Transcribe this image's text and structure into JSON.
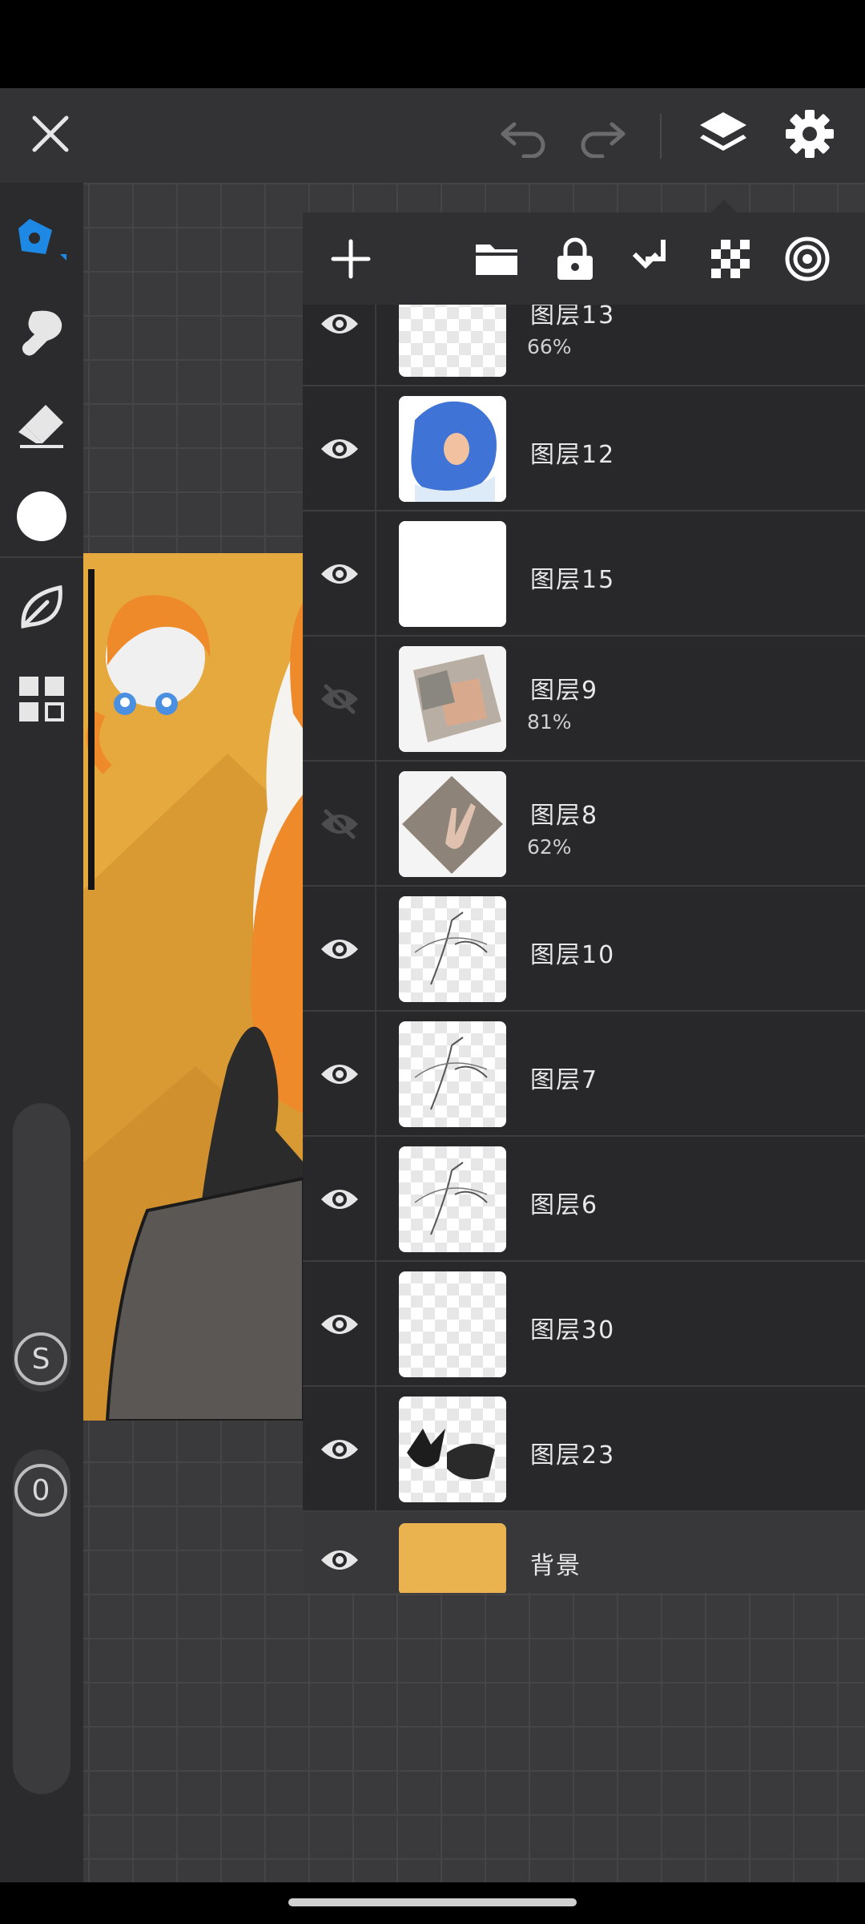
{
  "top_bar": {
    "close_icon": "close-icon",
    "undo_icon": "undo-icon",
    "redo_icon": "redo-icon",
    "layers_icon": "layers-icon",
    "settings_icon": "gear-icon"
  },
  "left_toolbar": {
    "tools": [
      "brush-icon",
      "smudge-icon",
      "eraser-icon",
      "color-swatch",
      "leaf-icon",
      "grid-icon"
    ],
    "active_color": "#ffffff",
    "size_label": "S",
    "opacity_label": "0"
  },
  "layers_toolbar": {
    "icons": [
      "add-layer-icon",
      "folder-icon",
      "lock-icon",
      "merge-down-icon",
      "alpha-lock-icon",
      "target-icon"
    ]
  },
  "layers": [
    {
      "name": "图层13",
      "opacity": "66%",
      "visible": true,
      "thumb": "empty"
    },
    {
      "name": "图层12",
      "opacity": "",
      "visible": true,
      "thumb": "blue"
    },
    {
      "name": "图层15",
      "opacity": "",
      "visible": true,
      "thumb": "white"
    },
    {
      "name": "图层9",
      "opacity": "81%",
      "visible": false,
      "thumb": "photo"
    },
    {
      "name": "图层8",
      "opacity": "62%",
      "visible": false,
      "thumb": "photo2"
    },
    {
      "name": "图层10",
      "opacity": "",
      "visible": true,
      "thumb": "sketch"
    },
    {
      "name": "图层7",
      "opacity": "",
      "visible": true,
      "thumb": "sketch"
    },
    {
      "name": "图层6",
      "opacity": "",
      "visible": true,
      "thumb": "sketch"
    },
    {
      "name": "图层30",
      "opacity": "",
      "visible": true,
      "thumb": "empty"
    },
    {
      "name": "图层23",
      "opacity": "",
      "visible": true,
      "thumb": "dark"
    },
    {
      "name": "背景",
      "opacity": "",
      "visible": true,
      "thumb": "orange"
    }
  ],
  "colors": {
    "background_layer": "#eab34f",
    "accent": "#1e88e5"
  }
}
